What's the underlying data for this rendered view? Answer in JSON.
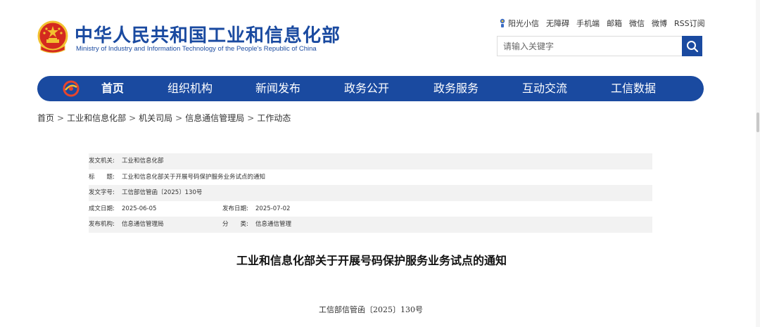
{
  "header": {
    "site_title": "中华人民共和国工业和信息化部",
    "site_subtitle": "Ministry of Industry and Information Technology of the People's Republic of China",
    "top_links": [
      "阳光小信",
      "无障碍",
      "手机端",
      "邮箱",
      "微信",
      "微博",
      "RSS订阅"
    ],
    "search_placeholder": "请输入关键字",
    "search_value": ""
  },
  "nav": {
    "items": [
      "首页",
      "组织机构",
      "新闻发布",
      "政务公开",
      "政务服务",
      "互动交流",
      "工信数据"
    ],
    "active_index": 0
  },
  "breadcrumb": {
    "items": [
      "首页",
      "工业和信息化部",
      "机关司局",
      "信息通信管理局",
      "工作动态"
    ],
    "separator": ">"
  },
  "metadata": {
    "issuer_label": "发文机关:",
    "issuer_value": "工业和信息化部",
    "title_label": "标　　题:",
    "title_value": "工业和信息化部关于开展号码保护服务业务试点的通知",
    "doc_no_label": "发文字号:",
    "doc_no_value": "工信部信管函〔2025〕130号",
    "created_label": "成文日期:",
    "created_value": "2025-06-05",
    "published_label": "发布日期:",
    "published_value": "2025-07-02",
    "org_label": "发布机构:",
    "org_value": "信息通信管理局",
    "category_label": "分　　类:",
    "category_value": "信息通信管理"
  },
  "document": {
    "title": "工业和信息化部关于开展号码保护服务业务试点的通知",
    "number": "工信部信管函〔2025〕130号"
  },
  "colors": {
    "brand_blue": "#1a4aa0",
    "emblem_red": "#d42a1f",
    "emblem_gold": "#f2c230"
  },
  "icons": {
    "emblem": "national-emblem-icon",
    "sunshine": "sunshine-icon",
    "search": "search-icon",
    "nav_logo": "miit-logo-icon"
  }
}
